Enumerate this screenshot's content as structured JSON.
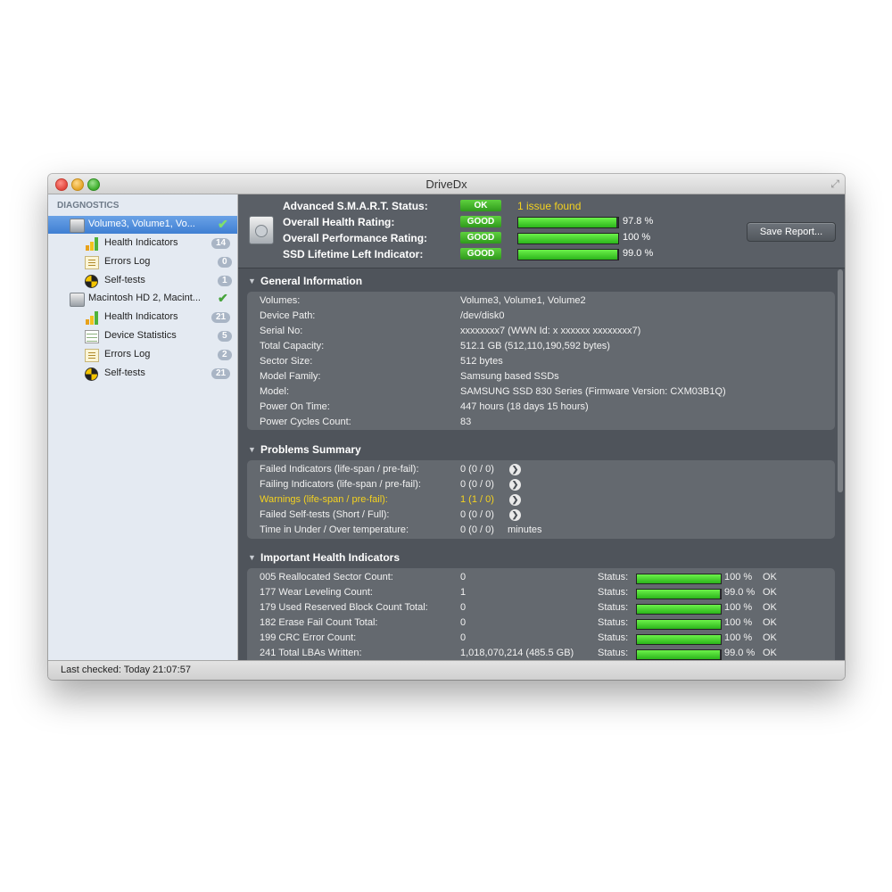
{
  "window": {
    "title": "DriveDx"
  },
  "sidebar": {
    "header": "DIAGNOSTICS",
    "drives": [
      {
        "label": "Volume3, Volume1, Vo...",
        "selected": true,
        "ok": true,
        "items": [
          {
            "label": "Health Indicators",
            "badge": "14",
            "icon": "health-bars-icon"
          },
          {
            "label": "Errors Log",
            "badge": "0",
            "icon": "log-icon"
          },
          {
            "label": "Self-tests",
            "badge": "1",
            "icon": "self-test-icon"
          }
        ]
      },
      {
        "label": "Macintosh HD 2, Macint...",
        "selected": false,
        "ok": true,
        "items": [
          {
            "label": "Health Indicators",
            "badge": "21",
            "icon": "health-bars-icon"
          },
          {
            "label": "Device Statistics",
            "badge": "5",
            "icon": "statistics-icon"
          },
          {
            "label": "Errors Log",
            "badge": "2",
            "icon": "log-icon"
          },
          {
            "label": "Self-tests",
            "badge": "21",
            "icon": "self-test-icon"
          }
        ]
      }
    ]
  },
  "status_bar": {
    "text": "Last checked: Today 21:07:57"
  },
  "summary": {
    "smart_label": "Advanced S.M.A.R.T. Status:",
    "smart_status": "OK",
    "smart_issue": "1 issue found",
    "health_label": "Overall Health Rating:",
    "health_status": "GOOD",
    "health_pct": "97.8 %",
    "health_value": 97.8,
    "perf_label": "Overall Performance Rating:",
    "perf_status": "GOOD",
    "perf_pct": "100 %",
    "perf_value": 100,
    "ssd_label": "SSD Lifetime Left Indicator:",
    "ssd_status": "GOOD",
    "ssd_pct": "99.0 %",
    "ssd_value": 99.0,
    "save_button": "Save Report..."
  },
  "general": {
    "title": "General Information",
    "rows": [
      {
        "k": "Volumes:",
        "v": "Volume3, Volume1, Volume2"
      },
      {
        "k": "Device Path:",
        "v": "/dev/disk0"
      },
      {
        "k": "Serial No:",
        "v": "xxxxxxxx7 (WWN Id: x xxxxxx xxxxxxxx7)"
      },
      {
        "k": "Total Capacity:",
        "v": "512.1 GB (512,110,190,592 bytes)"
      },
      {
        "k": "Sector Size:",
        "v": "512 bytes"
      },
      {
        "k": "Model Family:",
        "v": "Samsung based SSDs"
      },
      {
        "k": "Model:",
        "v": "SAMSUNG SSD 830 Series  (Firmware Version: CXM03B1Q)"
      },
      {
        "k": "Power On Time:",
        "v": "447 hours (18 days 15 hours)"
      },
      {
        "k": "Power Cycles Count:",
        "v": "83"
      }
    ]
  },
  "problems": {
    "title": "Problems Summary",
    "rows": [
      {
        "k": "Failed Indicators (life-span / pre-fail):",
        "v": "0 (0 / 0)"
      },
      {
        "k": "Failing Indicators (life-span / pre-fail):",
        "v": "0 (0 / 0)"
      },
      {
        "k": "Warnings (life-span / pre-fail):",
        "v": "1 (1 / 0)"
      },
      {
        "k": "Failed Self-tests (Short / Full):",
        "v": "0 (0 / 0)"
      },
      {
        "k": "Time in Under / Over temperature:",
        "v": "0 (0 / 0)",
        "unit": "minutes"
      }
    ]
  },
  "health": {
    "title": "Important Health Indicators",
    "status_label": "Status:",
    "rows": [
      {
        "k": "005  Reallocated Sector Count:",
        "v": "0",
        "pct": "100 %",
        "value": 100,
        "state": "OK"
      },
      {
        "k": "177  Wear Leveling Count:",
        "v": "1",
        "pct": "99.0 %",
        "value": 99.0,
        "state": "OK"
      },
      {
        "k": "179  Used Reserved Block Count Total:",
        "v": "0",
        "pct": "100 %",
        "value": 100,
        "state": "OK"
      },
      {
        "k": "182  Erase Fail Count Total:",
        "v": "0",
        "pct": "100 %",
        "value": 100,
        "state": "OK"
      },
      {
        "k": "199  CRC Error Count:",
        "v": "0",
        "pct": "100 %",
        "value": 100,
        "state": "OK"
      },
      {
        "k": "241  Total LBAs Written:",
        "v": "1,018,070,214 (485.5 GB)",
        "pct": "99.0 %",
        "value": 99.0,
        "state": "OK"
      }
    ]
  }
}
